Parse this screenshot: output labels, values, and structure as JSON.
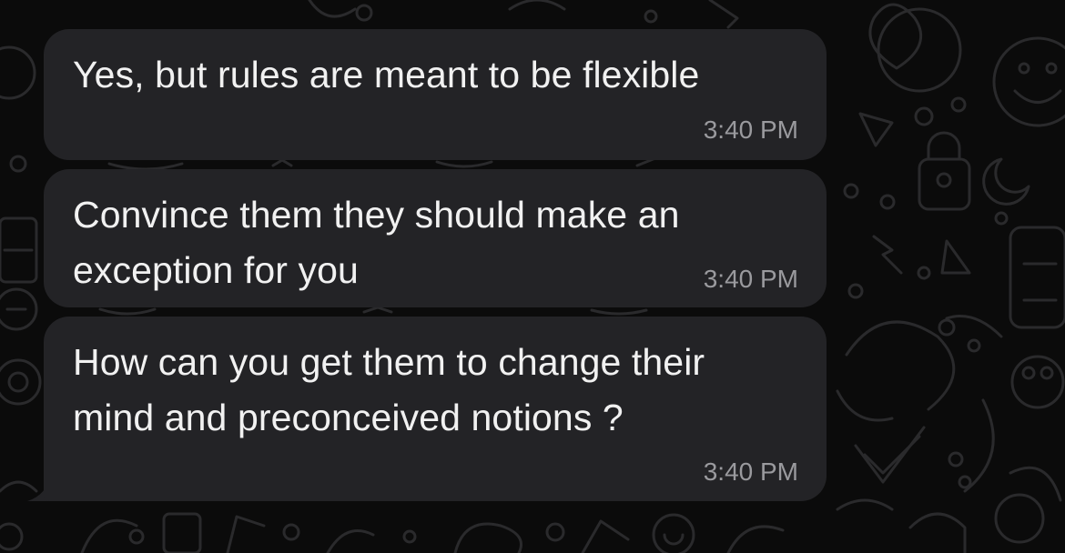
{
  "chat": {
    "messages": [
      {
        "text": "Yes, but rules are meant to be flexible",
        "time": "3:40 PM"
      },
      {
        "text_lines": [
          "Convince them they should make an",
          "exception for you"
        ],
        "time": "3:40 PM"
      },
      {
        "text_lines": [
          "How can you get them to change their",
          "mind and preconceived notions ?"
        ],
        "time": "3:40 PM"
      }
    ]
  },
  "colors": {
    "background": "#0b0b0b",
    "bubble": "#232326",
    "text": "#f1f1f1",
    "timestamp": "#9a9a9e",
    "doodle": "#2a2a2c"
  }
}
